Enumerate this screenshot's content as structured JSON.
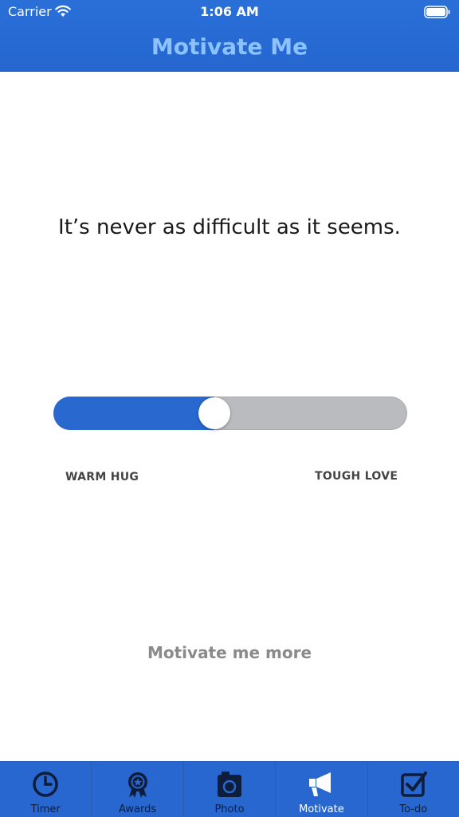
{
  "status_bar": {
    "carrier": "Carrier",
    "time": "1:06 AM"
  },
  "nav": {
    "title": "Motivate Me"
  },
  "quote": "It’s never as difficult as it seems.",
  "slider": {
    "value": 0.41,
    "left_label": "WARM HUG",
    "right_label": "TOUGH LOVE"
  },
  "more_button": "Motivate me more",
  "tabs": [
    {
      "label": "Timer",
      "icon": "clock-icon",
      "active": false
    },
    {
      "label": "Awards",
      "icon": "award-icon",
      "active": false
    },
    {
      "label": "Photo",
      "icon": "camera-icon",
      "active": false
    },
    {
      "label": "Motivate",
      "icon": "megaphone-icon",
      "active": true
    },
    {
      "label": "To-do",
      "icon": "checkbox-icon",
      "active": false
    }
  ],
  "colors": {
    "primary": "#2767cf",
    "title": "#8cc2ff",
    "tab_inactive": "#0d1d3a",
    "tab_active": "#ffffff"
  }
}
